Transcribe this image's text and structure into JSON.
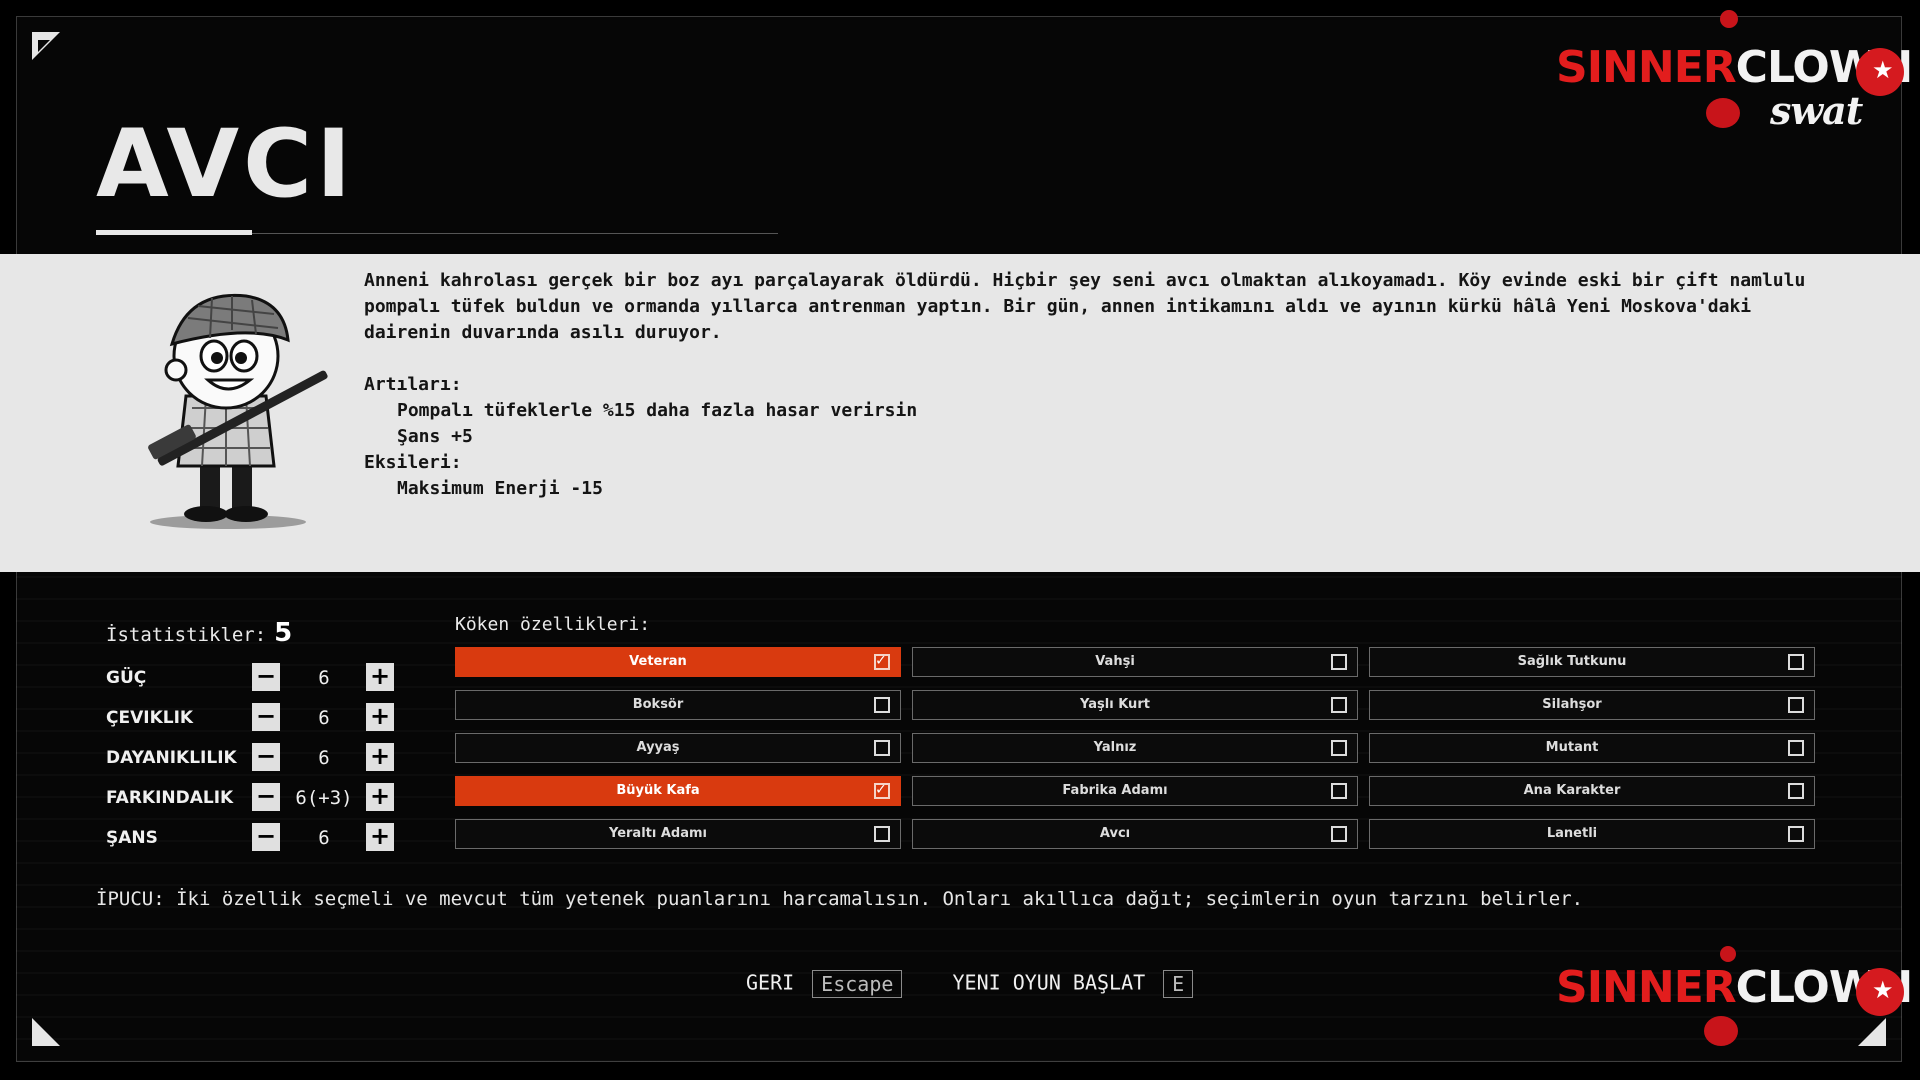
{
  "title": "AVCI",
  "logo": {
    "part1": "SINNER",
    "part2": "CLOWN",
    "sub": "swat"
  },
  "story": {
    "text": "Anneni kahrolası gerçek bir boz ayı parçalayarak öldürdü. Hiçbir şey seni avcı olmaktan alıkoyamadı. Köy evinde eski bir çift namlulu pompalı tüfek buldun ve ormanda yıllarca antrenman yaptın. Bir gün, annen intikamını aldı ve ayının kürkü hâlâ Yeni Moskova'daki dairenin duvarında asılı duruyor.",
    "pros_label": "Artıları:",
    "pros": [
      "Pompalı tüfeklerle %15 daha fazla hasar verirsin",
      "Şans +5"
    ],
    "cons_label": "Eksileri:",
    "cons": [
      "Maksimum Enerji -15"
    ]
  },
  "stats": {
    "label": "İstatistikler:",
    "points": "5",
    "items": [
      {
        "name": "GÜÇ",
        "value": "6"
      },
      {
        "name": "ÇEVIKLIK",
        "value": "6"
      },
      {
        "name": "DAYANIKLILIK",
        "value": "6"
      },
      {
        "name": "FARKINDALIK",
        "value": "6(+3)"
      },
      {
        "name": "ŞANS",
        "value": "6"
      }
    ],
    "minus": "−",
    "plus": "+"
  },
  "traits": {
    "label": "Köken özellikleri:",
    "items": [
      {
        "name": "Veteran",
        "selected": true
      },
      {
        "name": "Vahşi",
        "selected": false
      },
      {
        "name": "Sağlık Tutkunu",
        "selected": false
      },
      {
        "name": "Boksör",
        "selected": false
      },
      {
        "name": "Yaşlı Kurt",
        "selected": false
      },
      {
        "name": "Silahşor",
        "selected": false
      },
      {
        "name": "Ayyaş",
        "selected": false
      },
      {
        "name": "Yalnız",
        "selected": false
      },
      {
        "name": "Mutant",
        "selected": false
      },
      {
        "name": "Büyük Kafa",
        "selected": true
      },
      {
        "name": "Fabrika Adamı",
        "selected": false
      },
      {
        "name": "Ana Karakter",
        "selected": false
      },
      {
        "name": "Yeraltı Adamı",
        "selected": false
      },
      {
        "name": "Avcı",
        "selected": false
      },
      {
        "name": "Lanetli",
        "selected": false
      }
    ]
  },
  "tip": "İPUCU: İki özellik seçmeli ve mevcut tüm yetenek puanlarını harcamalısın. Onları akıllıca dağıt; seçimlerin oyun tarzını belirler.",
  "footer": {
    "back_label": "GERI",
    "back_key": "Escape",
    "start_label": "YENI OYUN BAŞLAT",
    "start_key": "E"
  },
  "colors": {
    "accent": "#d93a0f",
    "panel": "#e7e7e7",
    "background": "#060606"
  }
}
